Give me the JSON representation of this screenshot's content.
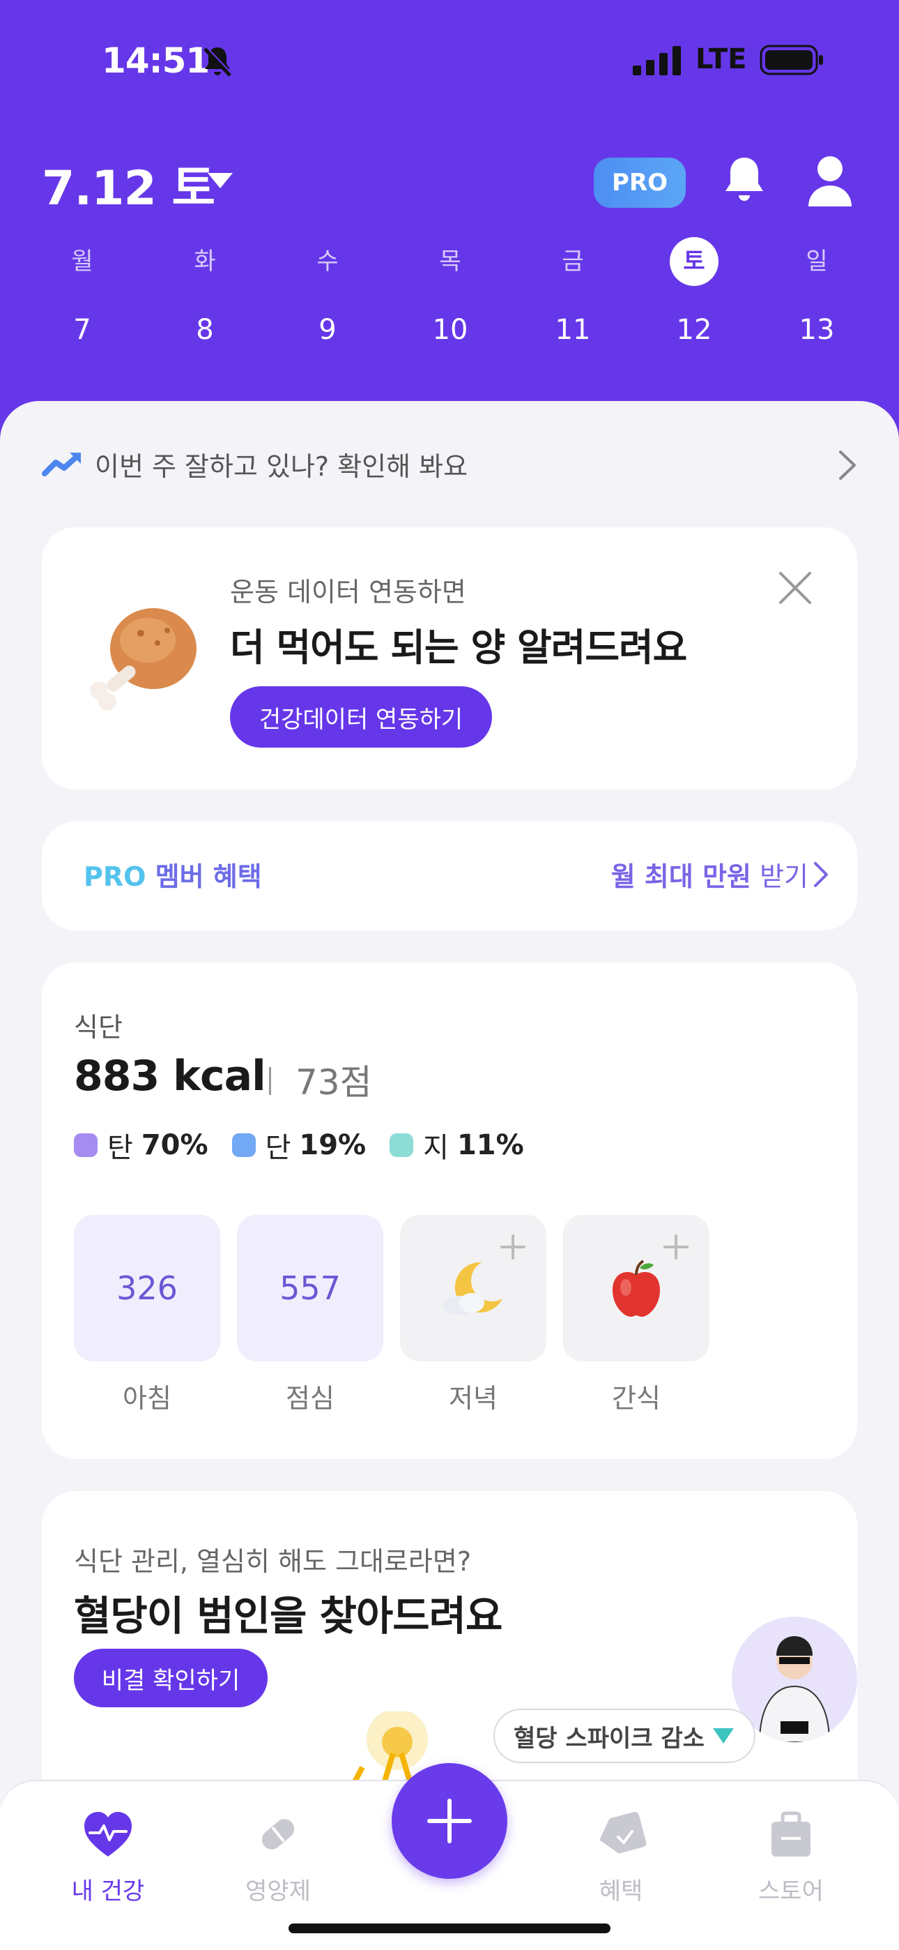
{
  "status": {
    "time": "14:51",
    "network": "LTE"
  },
  "header": {
    "date": "7.12 토",
    "pro_badge": "PRO",
    "week": [
      {
        "name": "월",
        "num": "7"
      },
      {
        "name": "화",
        "num": "8"
      },
      {
        "name": "수",
        "num": "9"
      },
      {
        "name": "목",
        "num": "10"
      },
      {
        "name": "금",
        "num": "11"
      },
      {
        "name": "토",
        "num": "12",
        "selected": true
      },
      {
        "name": "일",
        "num": "13"
      }
    ]
  },
  "weekly_check": {
    "text": "이번 주 잘하고 있나? 확인해 봐요"
  },
  "exercise_card": {
    "subtitle": "운동 데이터 연동하면",
    "title": "더 먹어도 되는 양 알려드려요",
    "button": "건강데이터 연동하기"
  },
  "pro_card": {
    "label_pro": "PRO",
    "label_rest": " 멤버 혜택",
    "benefit_bold": "월 최대 만원",
    "benefit_rest": " 받기"
  },
  "diet_card": {
    "label": "식단",
    "kcal": "883 kcal",
    "score": "73점",
    "macros": [
      {
        "name": "탄",
        "pct": "70%",
        "color": "#A58CF0"
      },
      {
        "name": "단",
        "pct": "19%",
        "color": "#72A8F4"
      },
      {
        "name": "지",
        "pct": "11%",
        "color": "#8EDCD6"
      }
    ],
    "meals": [
      {
        "label": "아침",
        "value": "326",
        "icon": "none"
      },
      {
        "label": "점심",
        "value": "557",
        "icon": "none"
      },
      {
        "label": "저녁",
        "value": "",
        "icon": "moon-icon"
      },
      {
        "label": "간식",
        "value": "",
        "icon": "apple-icon"
      }
    ]
  },
  "glucose_card": {
    "subtitle": "식단 관리, 열심히 해도 그대로라면?",
    "title": "혈당이 범인을 찾아드려요",
    "button": "비결 확인하기"
  },
  "spike_tag": {
    "text": "혈당 스파이크 감소"
  },
  "tabbar": {
    "tabs": [
      {
        "label": "내 건강",
        "icon": "heart-pulse-icon",
        "active": true
      },
      {
        "label": "영양제",
        "icon": "pill-icon"
      },
      {
        "label": "혜택",
        "icon": "tag-icon"
      },
      {
        "label": "스토어",
        "icon": "bag-icon"
      }
    ]
  },
  "colors": {
    "brand": "#6637E9",
    "background": "#F4F3F8"
  }
}
